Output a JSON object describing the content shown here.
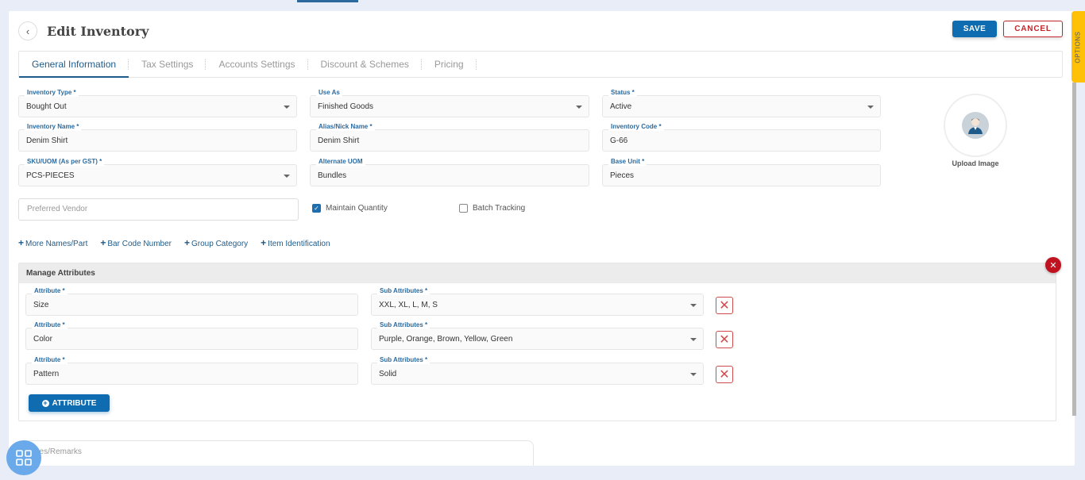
{
  "header": {
    "title": "Edit Inventory",
    "save_label": "SAVE",
    "cancel_label": "CANCEL"
  },
  "tabs": [
    {
      "label": "General Information",
      "active": true
    },
    {
      "label": "Tax Settings",
      "active": false
    },
    {
      "label": "Accounts Settings",
      "active": false
    },
    {
      "label": "Discount & Schemes",
      "active": false
    },
    {
      "label": "Pricing",
      "active": false
    }
  ],
  "fields": {
    "inventory_type": {
      "label": "Inventory Type *",
      "value": "Bought Out"
    },
    "use_as": {
      "label": "Use As",
      "value": "Finished Goods"
    },
    "status": {
      "label": "Status *",
      "value": "Active"
    },
    "inventory_name": {
      "label": "Inventory Name *",
      "value": "Denim Shirt"
    },
    "alias_name": {
      "label": "Alias/Nick Name *",
      "value": "Denim Shirt"
    },
    "inventory_code": {
      "label": "Inventory Code *",
      "value": "G-66"
    },
    "sku_uom": {
      "label": "SKU/UOM (As per GST) *",
      "value": "PCS-PIECES"
    },
    "alternate_uom": {
      "label": "Alternate UOM",
      "value": "Bundles"
    },
    "base_unit": {
      "label": "Base Unit *",
      "value": "Pieces"
    },
    "preferred_vendor": {
      "placeholder": "Preferred Vendor"
    }
  },
  "checkboxes": {
    "maintain_quantity": {
      "label": "Maintain Quantity",
      "checked": true
    },
    "batch_tracking": {
      "label": "Batch Tracking",
      "checked": false
    }
  },
  "links": [
    "More Names/Part",
    "Bar Code Number",
    "Group Category",
    "Item Identification"
  ],
  "upload": {
    "label": "Upload Image"
  },
  "attributes": {
    "title": "Manage Attributes",
    "attr_label": "Attribute *",
    "sub_label": "Sub Attributes *",
    "rows": [
      {
        "attribute": "Size",
        "sub": "XXL, XL, L, M, S"
      },
      {
        "attribute": "Color",
        "sub": "Purple, Orange, Brown, Yellow, Green"
      },
      {
        "attribute": "Pattern",
        "sub": "Solid"
      }
    ],
    "add_label": "ATTRIBUTE"
  },
  "notes": {
    "placeholder": "Notes/Remarks"
  },
  "options_label": "OPTIONS",
  "colors": {
    "primary": "#0f6cb0",
    "danger": "#c1121f",
    "options": "#ffc107"
  }
}
